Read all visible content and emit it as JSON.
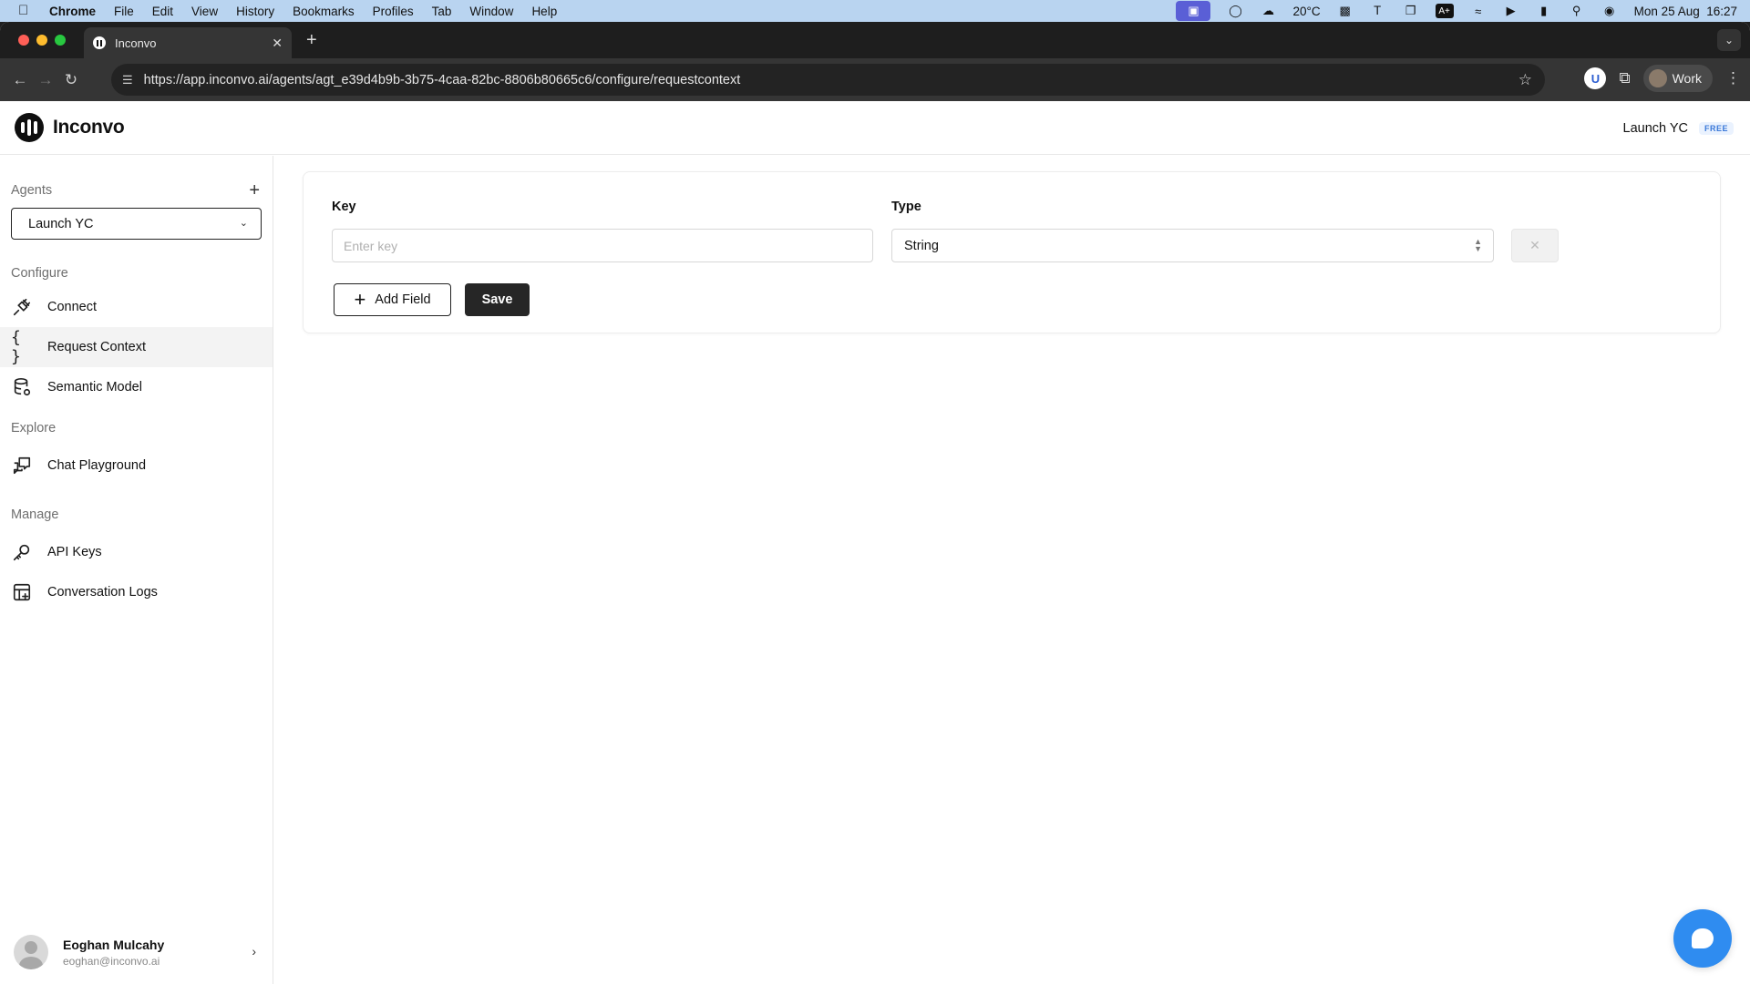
{
  "menubar": {
    "app": "Chrome",
    "items": [
      "File",
      "Edit",
      "View",
      "History",
      "Bookmarks",
      "Profiles",
      "Tab",
      "Window",
      "Help"
    ],
    "weather": "20°C",
    "datetime": "Mon 25 Aug  16:27",
    "font_badge": "A+"
  },
  "browser": {
    "tab_title": "Inconvo",
    "url": "https://app.inconvo.ai/agents/agt_e39d4b9b-3b75-4caa-82bc-8806b80665c6/configure/requestcontext",
    "profile": "Work"
  },
  "app": {
    "brand": "Inconvo",
    "header_agent": "Launch YC",
    "plan_badge": "FREE"
  },
  "sidebar": {
    "agents_title": "Agents",
    "selected_agent": "Launch YC",
    "configure_title": "Configure",
    "explore_title": "Explore",
    "manage_title": "Manage",
    "items": {
      "connect": "Connect",
      "request_context": "Request Context",
      "semantic_model": "Semantic Model",
      "chat_playground": "Chat Playground",
      "api_keys": "API Keys",
      "conversation_logs": "Conversation Logs"
    },
    "user": {
      "name": "Eoghan Mulcahy",
      "email": "eoghan@inconvo.ai"
    }
  },
  "form": {
    "key_label": "Key",
    "type_label": "Type",
    "key_placeholder": "Enter key",
    "key_value": "",
    "type_value": "String",
    "add_field_label": "Add Field",
    "save_label": "Save"
  }
}
